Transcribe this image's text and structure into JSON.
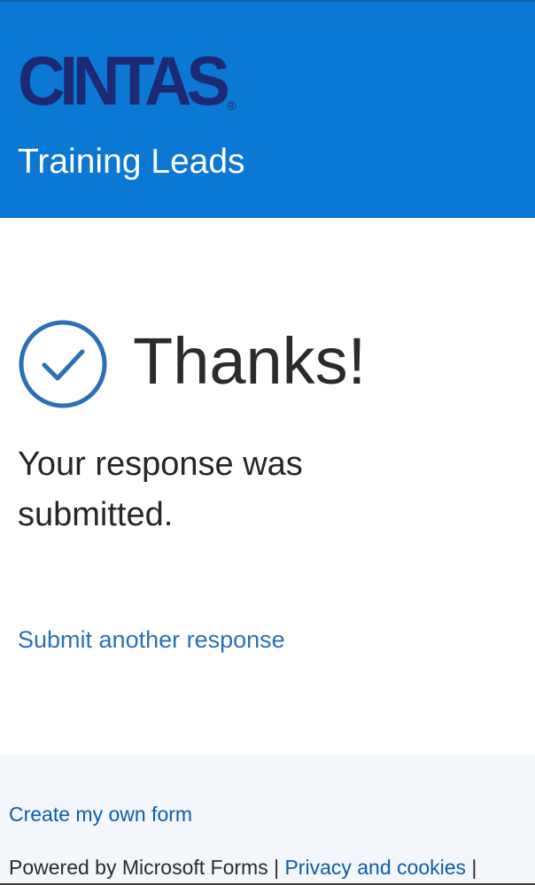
{
  "header": {
    "logo_text": "CINTAS",
    "logo_registered": "®",
    "form_title": "Training Leads"
  },
  "confirmation": {
    "heading": "Thanks!",
    "message": "Your response was submitted.",
    "submit_another_label": "Submit another response"
  },
  "footer": {
    "create_form_label": "Create my own form",
    "powered_by": "Powered by Microsoft Forms",
    "separator": "|",
    "privacy_label": "Privacy and cookies",
    "trailing_separator": "|"
  },
  "colors": {
    "header_bg": "#0a78d4",
    "logo_navy": "#1d2a73",
    "accent_blue": "#2a70b8",
    "footer_bg": "#f3f7fc"
  },
  "icons": {
    "check": "circle-check-icon"
  }
}
